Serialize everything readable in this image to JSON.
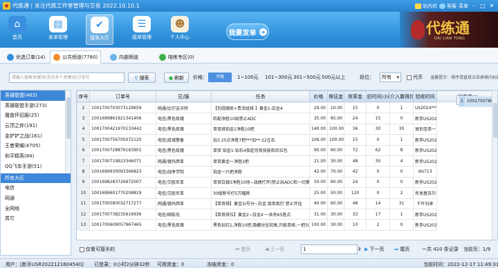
{
  "titlebar": {
    "title": "代练通 | 关注代练工作室管理与交易 2022.10.10.1",
    "items": [
      "站内信",
      "客服",
      "菜单"
    ]
  },
  "nav": {
    "buttons": [
      "首页",
      "发单管理",
      "接单大厅",
      "接单管理",
      "个人中心"
    ],
    "big_button": "我要发单"
  },
  "brand": {
    "name": "代练通",
    "sub": "DAI LIAN TONG"
  },
  "tabs": [
    "优选订单(14)",
    "公共频道(7780)",
    "内部频道",
    "陪练专区(0)"
  ],
  "filters": {
    "search_placeholder": "请输入搜索关键词(支持多个关键词)订单号",
    "search_btn": "搜索",
    "refresh_btn": "刷新",
    "price_label": "价格：",
    "price_options": [
      "不限",
      "1~100元",
      "101~300元",
      "301~500元",
      "500元以上"
    ],
    "rank_label": "段位：",
    "rank_value": "所有",
    "proxy_label": "代币",
    "tip": "温馨提示：排序请直接点击表格内标题"
  },
  "sidebar": {
    "games": [
      "英雄联盟(483)",
      "英雄联盟手游(273)",
      "魔兽怀旧服(25)",
      "云顶之弈(191)",
      "金铲铲之战(161)",
      "王者荣耀(4705)",
      "和平精英(84)",
      "QQ飞车手游(51)"
    ],
    "servers": [
      "所有大区",
      "电信",
      "网通",
      "全网络",
      "其它"
    ]
  },
  "table": {
    "headers": [
      "序号",
      "订单号",
      "区/服",
      "任务",
      "价格",
      "保证金",
      "效率金",
      "总时间(小时)",
      "介入赢得比",
      "验收时间",
      "发布者"
    ],
    "rows": [
      [
        "1",
        "1001700789152539016",
        "电信/黑色玫瑰",
        "单双排 白金3-钻石4（已有30点）包补分",
        "60.00",
        "50.00",
        "72",
        "66",
        "16",
        "新手US20221010230054"
      ],
      [
        "2",
        "1001700703073129659",
        "网通/比尔吉沃特",
        "【包段随练+贵活组排 】黄金1-白金4",
        "29.00",
        "10.00",
        "15",
        "0",
        "1",
        "US2024****72731"
      ],
      [
        "3",
        "1001699861921341406",
        "电信/黑色玫瑰",
        "匹配净胜10局禁止ADC",
        "35.00",
        "95.00",
        "24",
        "15",
        "0",
        "新手US20220725074907"
      ],
      [
        "4",
        "1001700421970133442",
        "电信/黑色玫瑰",
        "单双排铂金1净胜10把",
        "140.00",
        "100.00",
        "36",
        "30",
        "30",
        "琥珀宝单一"
      ],
      [
        "5",
        "1001700756705072120",
        "电信/皮城警备",
        "钻3.25点净胜7把***加**·22左右",
        "106.00",
        "100.00",
        "15",
        "0",
        "1",
        "新手US20220704005404"
      ],
      [
        "6",
        "1001700728879163901",
        "电信/黑色玫瑰",
        "单双 铂金1-钻石4指定司英技能和尼拉包",
        "90.00",
        "60.00",
        "72",
        "62",
        "8",
        "新手US20221128076618"
      ],
      [
        "7",
        "1001700719923346071",
        "网通/德玛西亚",
        "单双黄金一净胜3把",
        "21.00",
        "30.00",
        "48",
        "30",
        "4",
        "新手US20221006043932"
      ],
      [
        "8",
        "1001699930093366823",
        "电信/战争学院",
        "铂金一六把净胜",
        "42.00",
        "70.00",
        "42",
        "0",
        "0",
        "dis713"
      ],
      [
        "9",
        "1001698283726972007",
        "电信/艾欧尼亚",
        "单双白银3净胜10场~战绩打开(禁止玩ADC和一切第三方插件)",
        "50.00",
        "60.00",
        "24",
        "0",
        "0",
        "新手US20221001204100"
      ],
      [
        "10",
        "1001699601770208819",
        "电信/艾欧尼亚",
        "30级新号打5万幅称",
        "25.00",
        "50.00",
        "120",
        "0",
        "2",
        "有发基苏尔价单看要求"
      ],
      [
        "11",
        "1001700580032717277",
        "网通/德玛西亚",
        "【单双排】黄金3/号分~白金 接单就打 禁止开挂",
        "40.00",
        "60.00",
        "48",
        "14",
        "31",
        "千叶归来"
      ],
      [
        "12",
        "1001700738235616936",
        "电信/暗影岛",
        "【单双排位】黄金2~白金4 一共有65胜点",
        "31.00",
        "30.00",
        "33",
        "17",
        "1",
        "新手US20220324064057"
      ],
      [
        "13",
        "1001700609057967465",
        "电信/黑色玫瑰",
        "黑色钻石1,净胜10把,隐藏分比较高,只能单排,一把500",
        "100.00",
        "30.00",
        "10",
        "2",
        "0",
        "新手US20220802801788"
      ]
    ]
  },
  "pager": {
    "only_can_take": "仅看可接手的",
    "first": "首页",
    "prev": "上一页",
    "page_value": "1",
    "next": "下一页",
    "last": "尾页",
    "summary": "一共 410 条记录　当前页：1/9"
  },
  "status": {
    "user": "用户：[新手USR2022121604540]",
    "deposit": "已登录：0小时2分钟32秒",
    "available": "可用资金：0",
    "frozen": "冻结资金：0",
    "time": "当前时间：2022-12-17 11:49:31"
  }
}
